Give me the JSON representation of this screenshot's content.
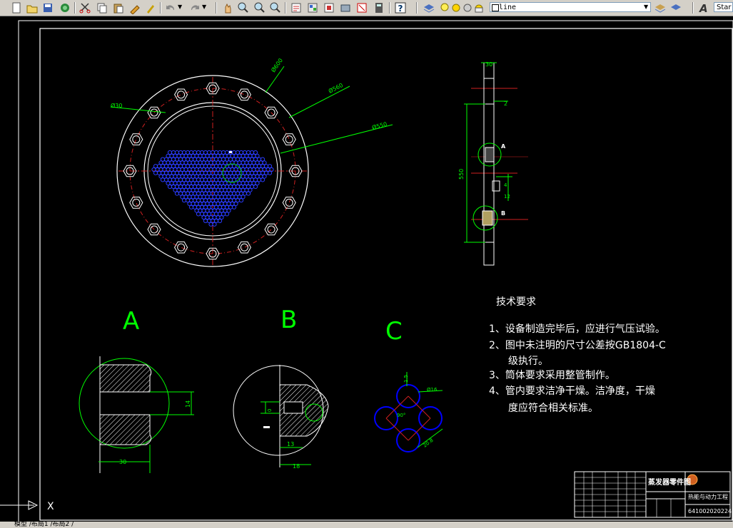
{
  "toolbar": {
    "linetype_value": "line",
    "style_value": "Star"
  },
  "drawing": {
    "dims": {
      "d600": "Ø600",
      "d560": "Ø560",
      "d550": "Ø550",
      "d30": "Ø30",
      "w30": "30",
      "c2": "2",
      "len550": "550",
      "n4": "4",
      "n12": "12",
      "dA": "14",
      "dA_w": "30",
      "dB_0": "0",
      "dB_13": "13",
      "dB_18": "18",
      "dC_15": "1.5",
      "dC_16": "Ø16",
      "dC_90": "90°",
      "dC_20": "20.8"
    },
    "markers": {
      "a": "A",
      "b": "B"
    },
    "views": {
      "a": "A",
      "b": "B",
      "c": "C"
    },
    "tech": {
      "title": "技术要求",
      "l1": "1、设备制造完毕后，应进行气压试验。",
      "l2": "2、图中未注明的尺寸公差按GB1804-C",
      "l2b": "级执行。",
      "l3": "3、筒体要求采用整管制作。",
      "l4": "4、管内要求洁净干燥。洁净度，干燥",
      "l4b": "度应符合相关标准。"
    },
    "title_block": {
      "name": "蒸发器零件图",
      "dept": "热能与动力工程",
      "number": "641002020224"
    },
    "ucs_x": "X"
  },
  "status": {
    "tabs": "模型 /布局1 /布局2 /"
  }
}
